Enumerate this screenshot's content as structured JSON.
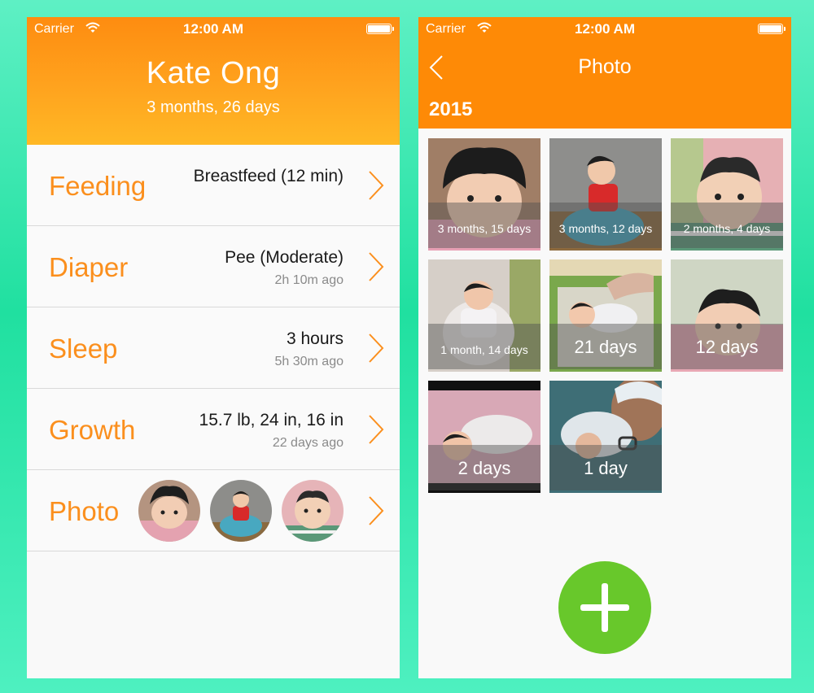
{
  "status_bar": {
    "carrier": "Carrier",
    "time": "12:00 AM"
  },
  "profile": {
    "name": "Kate Ong",
    "age": "3 months, 26 days"
  },
  "records": [
    {
      "label": "Feeding",
      "value": "Breastfeed (12 min)",
      "sub": ""
    },
    {
      "label": "Diaper",
      "value": "Pee (Moderate)",
      "sub": "2h 10m ago"
    },
    {
      "label": "Sleep",
      "value": "3 hours",
      "sub": "5h 30m ago"
    },
    {
      "label": "Growth",
      "value": "15.7 lb, 24 in, 16 in",
      "sub": "22 days ago"
    },
    {
      "label": "Photo"
    }
  ],
  "photo_screen": {
    "title": "Photo",
    "year": "2015",
    "photos": [
      {
        "caption": "3 months, 15 days"
      },
      {
        "caption": "3 months, 12 days"
      },
      {
        "caption": "2 months, 4 days"
      },
      {
        "caption": "1 month, 14 days"
      },
      {
        "caption": "21 days"
      },
      {
        "caption": "12 days"
      },
      {
        "caption": "2 days"
      },
      {
        "caption": "1 day"
      }
    ]
  },
  "colors": {
    "accent_orange": "#fb8f1d",
    "header_orange": "#fe8a06",
    "add_green": "#68c82b",
    "background_mint": "#20e0a0"
  },
  "icons": [
    "wifi-icon",
    "battery-icon",
    "chevron-right-icon",
    "chevron-left-icon",
    "plus-icon"
  ]
}
